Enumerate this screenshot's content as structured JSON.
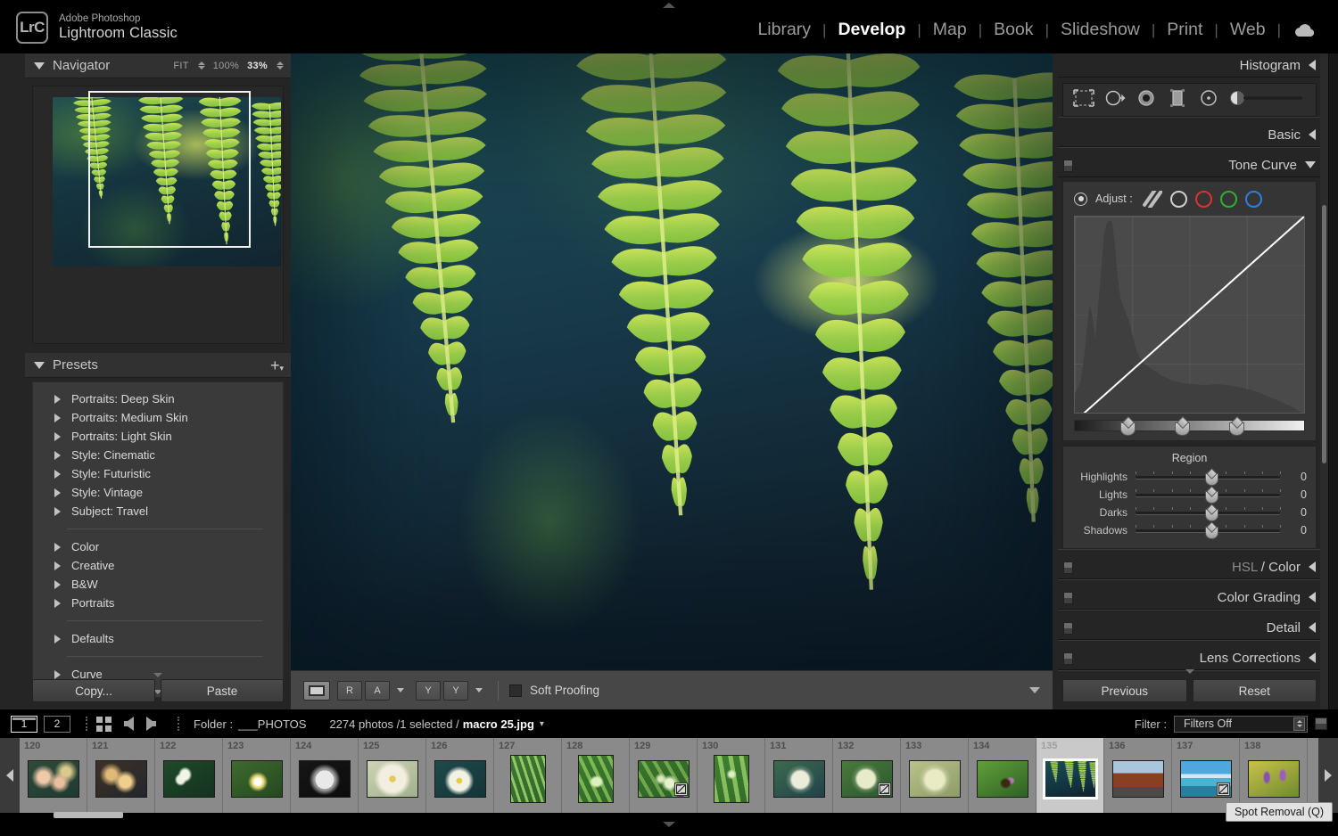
{
  "app": {
    "brand_sub": "Adobe Photoshop",
    "brand_main": "Lightroom Classic",
    "logo_text": "LrC"
  },
  "module_nav": {
    "items": [
      {
        "label": "Library",
        "active": false
      },
      {
        "label": "Develop",
        "active": true
      },
      {
        "label": "Map",
        "active": false
      },
      {
        "label": "Book",
        "active": false
      },
      {
        "label": "Slideshow",
        "active": false
      },
      {
        "label": "Print",
        "active": false
      },
      {
        "label": "Web",
        "active": false
      }
    ],
    "separator": "|",
    "cloud_icon": "cloud-sync-icon"
  },
  "navigator": {
    "title": "Navigator",
    "fit_label": "FIT",
    "zoom_100": "100%",
    "zoom_current": "33%"
  },
  "presets": {
    "title": "Presets",
    "add_icon": "plus-icon",
    "groups": [
      {
        "items": [
          "Portraits: Deep Skin",
          "Portraits: Medium Skin",
          "Portraits: Light Skin",
          "Style: Cinematic",
          "Style: Futuristic",
          "Style: Vintage",
          "Subject: Travel"
        ]
      },
      {
        "items": [
          "Color",
          "Creative",
          "B&W",
          "Portraits"
        ]
      },
      {
        "items": [
          "Defaults"
        ]
      },
      {
        "items": [
          "Curve"
        ]
      }
    ]
  },
  "left_buttons": {
    "copy": "Copy...",
    "paste": "Paste"
  },
  "right_panel": {
    "histogram": {
      "label": "Histogram"
    },
    "tools": [
      "crop-overlay-icon",
      "spot-removal-icon",
      "red-eye-correction-icon",
      "masking-icon",
      "radial-gradient-icon",
      "adjustment-brush-icon"
    ],
    "basic": {
      "label": "Basic"
    },
    "tone_curve": {
      "label": "Tone Curve",
      "adjust_label": "Adjust :",
      "adjust_modes": [
        "parametric-curve-icon",
        "point-curve-white-icon",
        "red-channel-icon",
        "green-channel-icon",
        "blue-channel-icon"
      ],
      "region_title": "Region",
      "sliders": [
        {
          "name": "Highlights",
          "value": "0"
        },
        {
          "name": "Lights",
          "value": "0"
        },
        {
          "name": "Darks",
          "value": "0"
        },
        {
          "name": "Shadows",
          "value": "0"
        }
      ]
    },
    "sections": [
      {
        "label": "HSL / Color",
        "label_a": "HSL",
        "label_sep": "/",
        "label_b": "Color"
      },
      {
        "label": "Color Grading"
      },
      {
        "label": "Detail"
      },
      {
        "label": "Lens Corrections"
      }
    ],
    "buttons": {
      "previous": "Previous",
      "reset": "Reset"
    }
  },
  "toolbar": {
    "view_icon": "loupe-view-icon",
    "before_after_label_r": "R",
    "before_after_label_a": "A",
    "yy_label_1": "Y",
    "yy_label_2": "Y",
    "soft_proofing": "Soft Proofing"
  },
  "filmstrip_bar": {
    "page1": "1",
    "page2": "2",
    "grid_icon": "grid-view-icon",
    "back_icon": "navigate-back-icon",
    "forward_icon": "navigate-forward-icon",
    "folder_label": "Folder :",
    "folder_name": "___PHOTOS",
    "count_text": "2274 photos /1 selected /",
    "filename": "macro 25.jpg",
    "filename_caret": "chevron-down-icon",
    "filter_label": "Filter :",
    "filter_value": "Filters Off"
  },
  "filmstrip": {
    "prev_icon": "filmstrip-prev-icon",
    "next_icon": "filmstrip-next-icon",
    "thumbnails": [
      {
        "num": "120",
        "orient": "landscape",
        "selected": false,
        "badge": null,
        "kind": "peach-blossoms"
      },
      {
        "num": "121",
        "orient": "landscape",
        "selected": false,
        "badge": null,
        "kind": "yellow-blossoms"
      },
      {
        "num": "122",
        "orient": "landscape",
        "selected": false,
        "badge": null,
        "kind": "white-flower-green"
      },
      {
        "num": "123",
        "orient": "landscape",
        "selected": false,
        "badge": null,
        "kind": "daisy-green"
      },
      {
        "num": "124",
        "orient": "landscape",
        "selected": false,
        "badge": null,
        "kind": "bw-daisy"
      },
      {
        "num": "125",
        "orient": "landscape",
        "selected": false,
        "badge": null,
        "kind": "pale-daisy"
      },
      {
        "num": "126",
        "orient": "landscape",
        "selected": false,
        "badge": null,
        "kind": "teal-daisy"
      },
      {
        "num": "127",
        "orient": "portrait",
        "selected": false,
        "badge": null,
        "kind": "grass-dew"
      },
      {
        "num": "128",
        "orient": "portrait",
        "selected": false,
        "badge": null,
        "kind": "dewdrop-blade"
      },
      {
        "num": "129",
        "orient": "landscape",
        "selected": false,
        "badge": "edited-badge",
        "kind": "dew-grass-wide"
      },
      {
        "num": "130",
        "orient": "portrait",
        "selected": false,
        "badge": null,
        "kind": "blade-dew"
      },
      {
        "num": "131",
        "orient": "landscape",
        "selected": false,
        "badge": null,
        "kind": "dandelion-teal"
      },
      {
        "num": "132",
        "orient": "landscape",
        "selected": false,
        "badge": "edited-badge",
        "kind": "dandelion-green"
      },
      {
        "num": "133",
        "orient": "landscape",
        "selected": false,
        "badge": null,
        "kind": "dandelion-pale"
      },
      {
        "num": "134",
        "orient": "landscape",
        "selected": false,
        "badge": null,
        "kind": "bee-leaf"
      },
      {
        "num": "135",
        "orient": "landscape",
        "selected": true,
        "badge": null,
        "kind": "fern"
      },
      {
        "num": "136",
        "orient": "landscape",
        "selected": false,
        "badge": null,
        "kind": "autumn-road"
      },
      {
        "num": "137",
        "orient": "landscape",
        "selected": false,
        "badge": "edited-badge",
        "kind": "beach-sky"
      },
      {
        "num": "138",
        "orient": "landscape",
        "selected": false,
        "badge": null,
        "kind": "purple-crocus"
      }
    ]
  },
  "tooltip": {
    "text": "Spot Removal (Q)"
  },
  "colors": {
    "panel_bg": "#252525",
    "panel_head": "#313131",
    "center_bg": "#373737",
    "accent_text": "#ffffff",
    "filmstrip_bg": "#8a8a8a",
    "selected_cell": "#c9c9c9",
    "red_channel": "#e03030",
    "green_channel": "#2fb02f",
    "blue_channel": "#2f7fe0"
  }
}
